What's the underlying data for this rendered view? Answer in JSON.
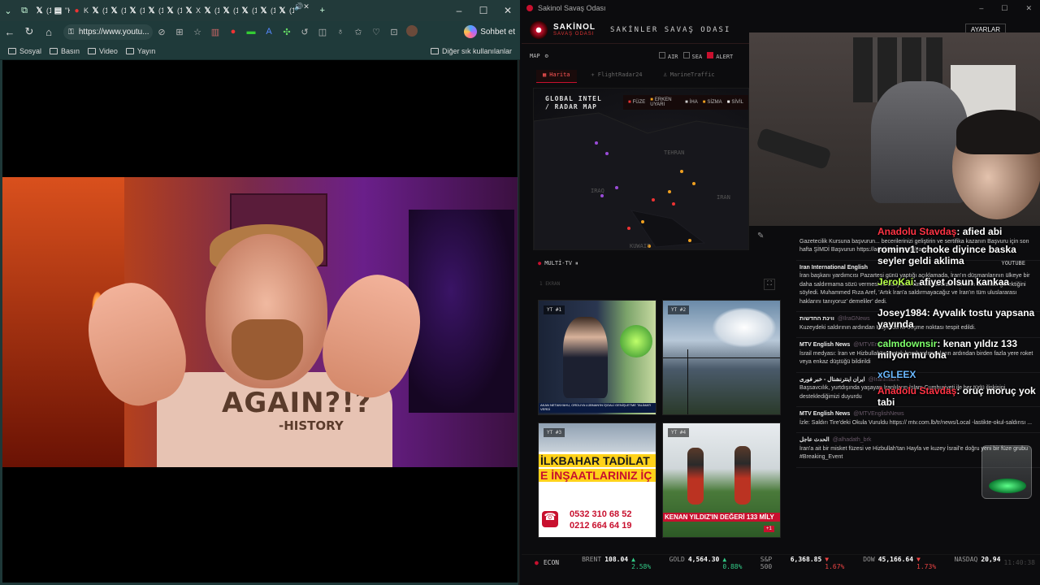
{
  "browser": {
    "tabs": [
      {
        "icon": "x-icon",
        "label": "(11"
      },
      {
        "icon": "page-icon",
        "label": "\"Kr"
      },
      {
        "icon": "kick-icon",
        "label": "Kicl"
      },
      {
        "icon": "x-icon",
        "label": "(12"
      },
      {
        "icon": "x-icon",
        "label": "(12"
      },
      {
        "icon": "x-icon",
        "label": "(12"
      },
      {
        "icon": "x-icon",
        "label": "(12"
      },
      {
        "icon": "x-icon",
        "label": "(12"
      },
      {
        "icon": "x-icon",
        "label": "X'ta"
      },
      {
        "icon": "x-icon",
        "label": "(12"
      },
      {
        "icon": "x-icon",
        "label": "(12"
      },
      {
        "icon": "x-icon",
        "label": "(12"
      },
      {
        "icon": "x-icon",
        "label": "(12"
      },
      {
        "icon": "x-icon",
        "label": "(12"
      }
    ],
    "url": "https://www.youtu...",
    "copilot_label": "Sohbet et",
    "bookmarks": [
      "Sosyal",
      "Basın",
      "Video",
      "Yayın"
    ],
    "bookmarks_other": "Diğer sık kullanılanlar",
    "thumbnail": {
      "shirt_text": "AGAIN?!?",
      "shirt_sub": "-HISTORY"
    }
  },
  "app": {
    "window_title": "Sakinol Savaş Odası",
    "brand": "SAKİNOL",
    "brand_sub": "SAVAŞ ODASI",
    "room_title": "SAKİNLER SAVAŞ ODASI",
    "settings_label": "AYARLAR",
    "map_label": "MAP",
    "filters": [
      {
        "label": "AIR",
        "on": false
      },
      {
        "label": "SEA",
        "on": false
      },
      {
        "label": "ALERT",
        "on": true
      }
    ],
    "map_tabs": [
      {
        "label": "Harita",
        "active": true
      },
      {
        "label": "FlightRadar24",
        "active": false
      },
      {
        "label": "MarineTraffic",
        "active": false
      }
    ],
    "map_title_1": "GLOBAL INTEL",
    "map_title_2": "/ RADAR MAP",
    "legend": [
      "FÜZE",
      "ERKEN UYARI",
      "İHA",
      "SİZMA",
      "SİVİL"
    ],
    "cities": [
      "TEHRAN",
      "IRAN",
      "IRAQ",
      "KUWAIT"
    ],
    "multitv_label": "MULTİ-TV",
    "multitv_source": "YOUTUBE",
    "multitv_sub": "1 EKRAN",
    "tvs": [
      {
        "label": "YT #1",
        "caption": "AKAN NETANYAHU, ORDUYA LÜBNAN'IN İŞGALİ GENİŞLETME TALİMATI VERDİ"
      },
      {
        "label": "YT #2",
        "caption": ""
      },
      {
        "label": "YT #3",
        "caption": "İLKBAHAR TADİLAT",
        "caption2": "E İNŞAATLARINIZ İÇ",
        "phone1": "0532 310 68 52",
        "phone2": "0212 664 64 19"
      },
      {
        "label": "YT #4",
        "caption": "KENAN YILDIZ'IN DEĞERİ 133 MİLY",
        "badge": "+1"
      }
    ],
    "news": [
      {
        "source": "",
        "handle": "",
        "body": "Gazetecilik Kursuna başvurun... becerilerinizi geliştirin ve sertifika kazanın Başvuru için son hafta ŞİMDİ Başvurun https://academy.rt.com/#apply"
      },
      {
        "source": "Iran International English",
        "handle": "",
        "body": "İran başkanı yardımcısı Pazartesi günü yaptığı açıklamada, İran'ın düşmanlarının ülkeye bir daha saldırmama sözü vermesi ve dünyanın tüm uluslararası hakların tanıması gerektiğini söyledi. Muhammed Rıza Aref, 'Artık İran'a saldırmayacağız ve İran'ın tüm uluslararası haklarını tanıyoruz' demeliler' dedi."
      },
      {
        "source": "ווינת החדשות",
        "handle": "@IlraGNews",
        "body": "Kuzeydeki saldırının ardından Hayfa'da iki düşme noktası tespit edildi."
      },
      {
        "source": "MTV English News",
        "handle": "@MTVEngNews",
        "body": "İsrail medyası: İran ve Hizbullah'tan ortak bombardımanların ardından birden fazla yere roket veya enkaz düştüğü bildirildi"
      },
      {
        "source": "ایران اینترنشنال - خبر فوری",
        "handle": "@IranIntlbrk",
        "body": "Başsavcılık, yurtdışında yaşayan İranlıların İslam Cumhuriyeti ile her türlü ilişkisini desteklediğimizi duyurdu"
      },
      {
        "source": "MTV English News",
        "handle": "@MTVEnglishNews",
        "body": "İzle: Saldırı Tire'deki Okula Vuruldu https:// mtv.com.lb/tr/news/Local -lastikte-okul-saldırısı ..."
      },
      {
        "source": "الحدث عاجل",
        "handle": "@alhadath_brk",
        "body": "İran'a ait bir misket füzesi ve Hizbullah'tan Hayfa ve kuzey İsrail'e doğru yeni bir füze grubu #Breaking_Event"
      }
    ],
    "chat": [
      {
        "user": "Anadolu Stavdaş",
        "text": "afied abi",
        "color": "#ff3344"
      },
      {
        "user": "rominv1",
        "text": "choke diyince baska seyler geldi aklima",
        "color": "#ffffff"
      },
      {
        "user": "JeroKai",
        "text": "afiyet olsun kankaa",
        "color": "#b7ff4a"
      },
      {
        "user": "Josey1984",
        "text": "Ayvalık tostu yapsana yayında",
        "color": "#ffffff"
      },
      {
        "user": "calmdownsir",
        "text": "kenan yıldız 133 milyon mu oha",
        "color": "#7dff6a"
      },
      {
        "user": "xGLEEX",
        "text": "",
        "color": "#6ab8ff"
      },
      {
        "user": "Anadolu Stavdaş",
        "text": "oruç moruç yok tabi",
        "color": "#ff3344"
      }
    ],
    "econ": {
      "label": "ECON",
      "items": [
        {
          "name": "BRENT",
          "value": "108.04",
          "change": "▲ 2.58%",
          "dir": "up"
        },
        {
          "name": "GOLD",
          "value": "4,564.30",
          "change": "▲ 0.88%",
          "dir": "up"
        },
        {
          "name": "S&P 500",
          "value": "6,368.85",
          "change": "▼ 1.67%",
          "dir": "dn"
        },
        {
          "name": "DOW",
          "value": "45,166.64",
          "change": "▼ 1.73%",
          "dir": "dn"
        },
        {
          "name": "NASDAQ",
          "value": "20,94",
          "change": "",
          "dir": "dn"
        }
      ],
      "time": "11:40:38"
    }
  }
}
